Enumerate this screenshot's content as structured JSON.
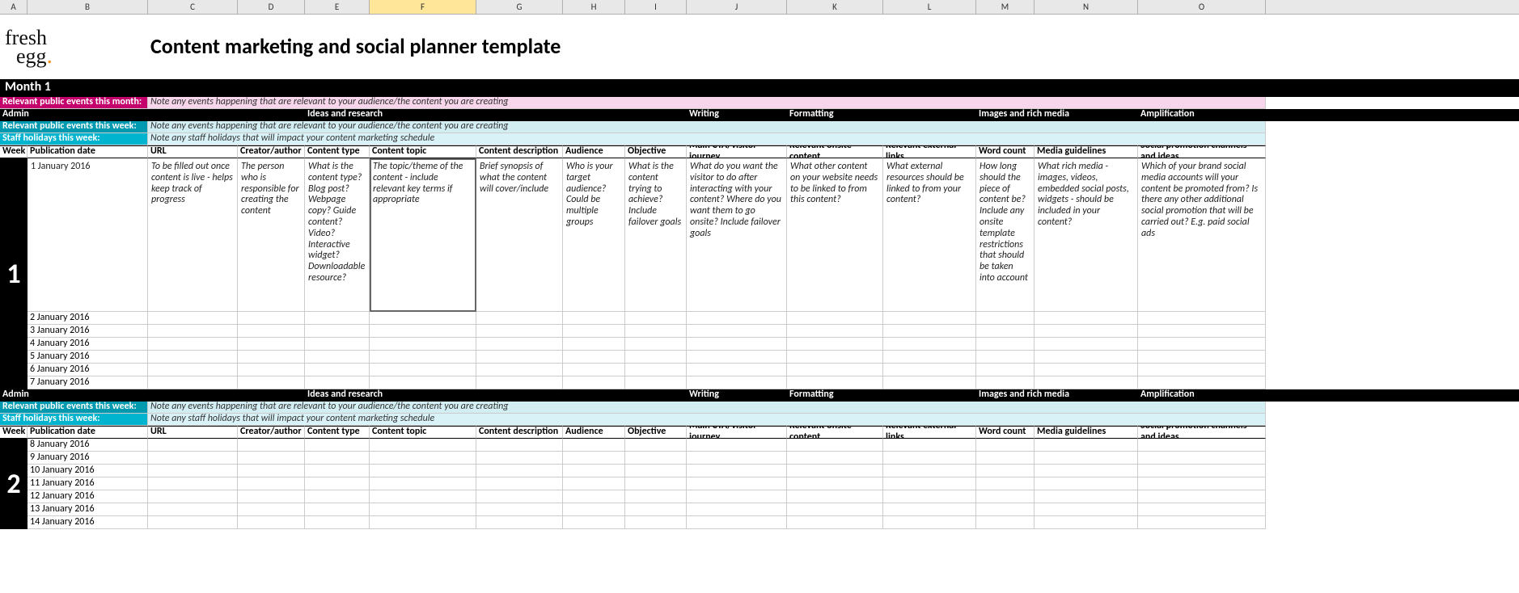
{
  "columns": [
    "A",
    "B",
    "C",
    "D",
    "E",
    "F",
    "G",
    "H",
    "I",
    "J",
    "K",
    "L",
    "M",
    "N",
    "O"
  ],
  "title": "Content marketing and social planner template",
  "logo_top": "fresh",
  "logo_bottom": "egg",
  "month_label": "Month 1",
  "pink_label": "Relevant public events this month:",
  "pink_note": "Note any events happening that are relevant to your audience/the content you are creating",
  "section_headers": {
    "admin": "Admin",
    "ideas": "Ideas and research",
    "writing": "Writing",
    "formatting": "Formatting",
    "images": "Images and rich media",
    "amplification": "Amplification"
  },
  "teal_label": "Relevant public events this week:",
  "teal_note": "Note any events happening that are relevant to your audience/the content you are creating",
  "cyan_label": "Staff holidays this week:",
  "cyan_note": "Note any staff holidays that will impact your content marketing schedule",
  "col_labels": {
    "week": "Week",
    "pub": "Publication date",
    "url": "URL",
    "creator": "Creator/author",
    "ctype": "Content type",
    "ctopic": "Content topic",
    "cdesc": "Content description",
    "aud": "Audience",
    "obj": "Objective",
    "cta": "Main CTA/visitor journey",
    "onsite": "Relevant onsite content",
    "ext": "Relevant external links",
    "wc": "Word count",
    "media": "Media guidelines",
    "social": "Social promotion channels and ideas"
  },
  "descriptions": {
    "pub": "1 January 2016",
    "url": "To be filled out once content is live - helps keep track of progress",
    "creator": "The person who is responsible for creating the content",
    "ctype": "What is the content type? Blog post? Webpage copy? Guide content? Video? Interactive widget? Downloadable resource?",
    "ctopic": "The topic/theme of the content - include relevant key terms if appropriate",
    "cdesc": "Brief synopsis of what the content will cover/include",
    "aud": "Who is your target audience? Could be multiple groups",
    "obj": "What is the content trying to achieve? Include failover goals",
    "cta": "What do you want the visitor to do after interacting with your content? Where do you want them to go onsite? Include failover goals",
    "onsite": "What other content on your website needs to be linked to from this content?",
    "ext": "What external resources should be linked to from your content?",
    "wc": "How long should the piece of content be? Include any onsite template restrictions that should be taken into account",
    "media": "What rich media - images, videos, embedded social posts, widgets - should be included in your content?",
    "social": "Which of your brand social media accounts will your content be promoted from? Is there any other additional social promotion that will be carried out? E.g. paid social ads"
  },
  "week1": {
    "num": "1",
    "dates": [
      "2 January 2016",
      "3 January 2016",
      "4 January 2016",
      "5 January 2016",
      "6 January 2016",
      "7 January 2016"
    ]
  },
  "week2": {
    "num": "2",
    "dates": [
      "8 January 2016",
      "9 January 2016",
      "10 January 2016",
      "11 January 2016",
      "12 January 2016",
      "13 January 2016",
      "14 January 2016"
    ]
  }
}
